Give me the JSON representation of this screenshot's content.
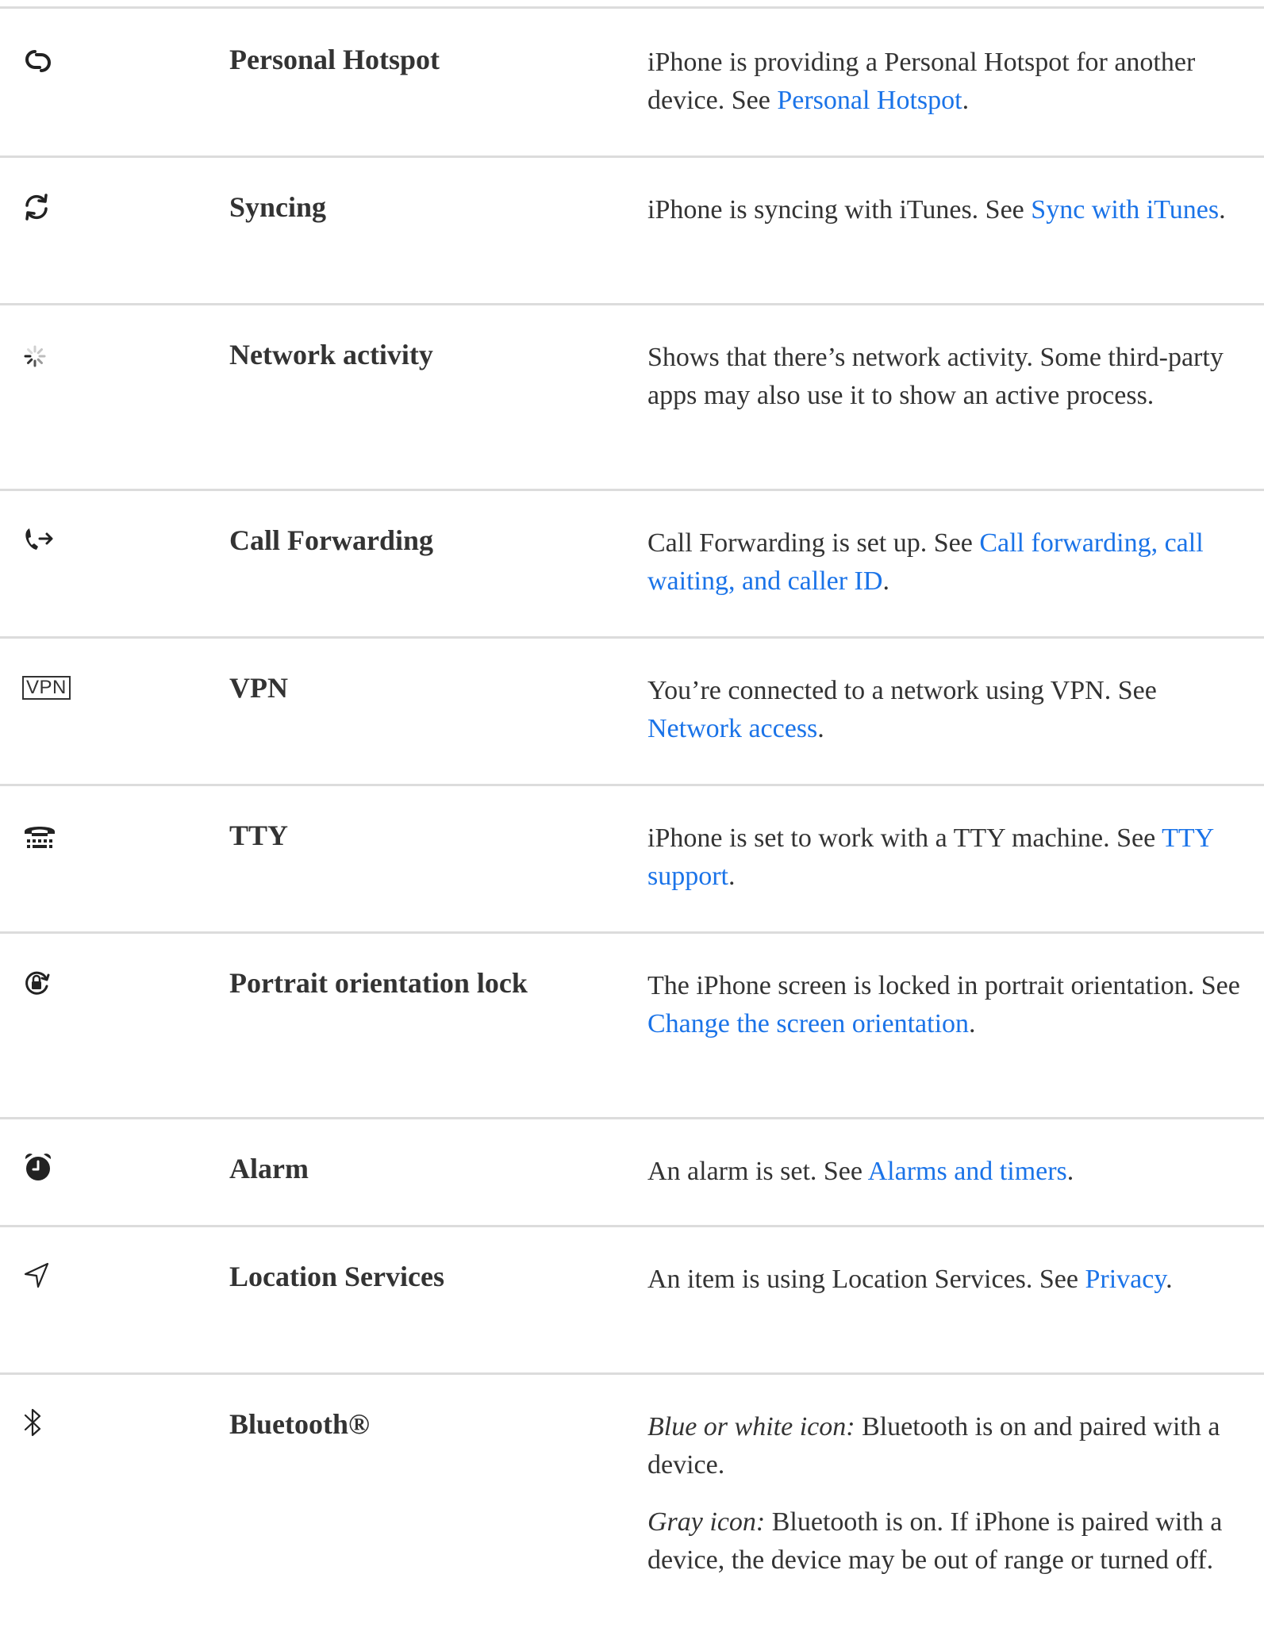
{
  "rows": [
    {
      "name": "Personal Hotspot",
      "icon": "personal-hotspot-icon",
      "desc_pre": "iPhone is providing a Personal Hotspot for another device. See ",
      "link": "Personal Hotspot",
      "desc_post": "."
    },
    {
      "name": "Syncing",
      "icon": "sync-icon",
      "desc_pre": "iPhone is syncing with iTunes. See ",
      "link": "Sync with iTunes",
      "desc_post": "."
    },
    {
      "name": "Network activity",
      "icon": "network-activity-icon",
      "desc_pre": "Shows that there’s network activity. Some third-party apps may also use it to show an active process.",
      "link": "",
      "desc_post": ""
    },
    {
      "name": "Call Forwarding",
      "icon": "call-forwarding-icon",
      "desc_pre": "Call Forwarding is set up. See ",
      "link": "Call forwarding, call waiting, and caller ID",
      "desc_post": "."
    },
    {
      "name": "VPN",
      "icon": "vpn-icon",
      "icon_text": "VPN",
      "desc_pre": "You’re connected to a network using VPN. See ",
      "link": "Network access",
      "desc_post": "."
    },
    {
      "name": "TTY",
      "icon": "tty-icon",
      "desc_pre": "iPhone is set to work with a TTY machine. See ",
      "link": "TTY support",
      "desc_post": "."
    },
    {
      "name": "Portrait orientation lock",
      "icon": "orientation-lock-icon",
      "desc_pre": "The iPhone screen is locked in portrait orientation. See ",
      "link": "Change the screen orientation",
      "desc_post": "."
    },
    {
      "name": "Alarm",
      "icon": "alarm-icon",
      "desc_pre": "An alarm is set. See ",
      "link": "Alarms and timers",
      "desc_post": "."
    },
    {
      "name": "Location Services",
      "icon": "location-icon",
      "desc_pre": "An item is using Location Services. See ",
      "link": "Privacy",
      "desc_post": "."
    },
    {
      "name": "Bluetooth®",
      "icon": "bluetooth-icon",
      "p1_label": "Blue or white icon:",
      "p1_text": " Bluetooth is on and paired with a device.",
      "p2_label": "Gray icon:",
      "p2_text": " Bluetooth is on. If iPhone is paired with a device, the device may be out of range or turned off."
    }
  ],
  "colors": {
    "link": "#1a73e8",
    "divider": "#dcdcdc",
    "text": "#333333"
  }
}
